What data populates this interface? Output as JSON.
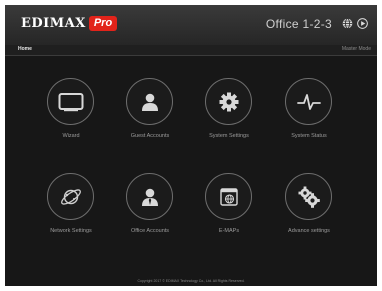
{
  "header": {
    "brand": "EDIMAX",
    "brand_badge": "Pro",
    "office_name": "Office 1-2-3",
    "globe_icon": "globe-icon",
    "logout_icon": "play-icon"
  },
  "subbar": {
    "home_label": "Home",
    "mode_label": "Master Mode"
  },
  "tiles": [
    {
      "label": "Wizard",
      "icon": "monitor-icon"
    },
    {
      "label": "Guest Accounts",
      "icon": "user-icon"
    },
    {
      "label": "System Settings",
      "icon": "gear-icon"
    },
    {
      "label": "System Status",
      "icon": "pulse-icon"
    },
    {
      "label": "Network Settings",
      "icon": "network-icon"
    },
    {
      "label": "Office Accounts",
      "icon": "user-icon"
    },
    {
      "label": "E-MAPs",
      "icon": "map-icon"
    },
    {
      "label": "Advance settings",
      "icon": "gears-icon"
    }
  ],
  "footer": {
    "copyright": "Copyright 2017 © EDIMAX Technology Co., Ltd. All Rights Reserved."
  },
  "colors": {
    "background": "#171717",
    "header": "#2e2e2e",
    "brand_red": "#e2231a",
    "icon": "#d8d8d8"
  }
}
